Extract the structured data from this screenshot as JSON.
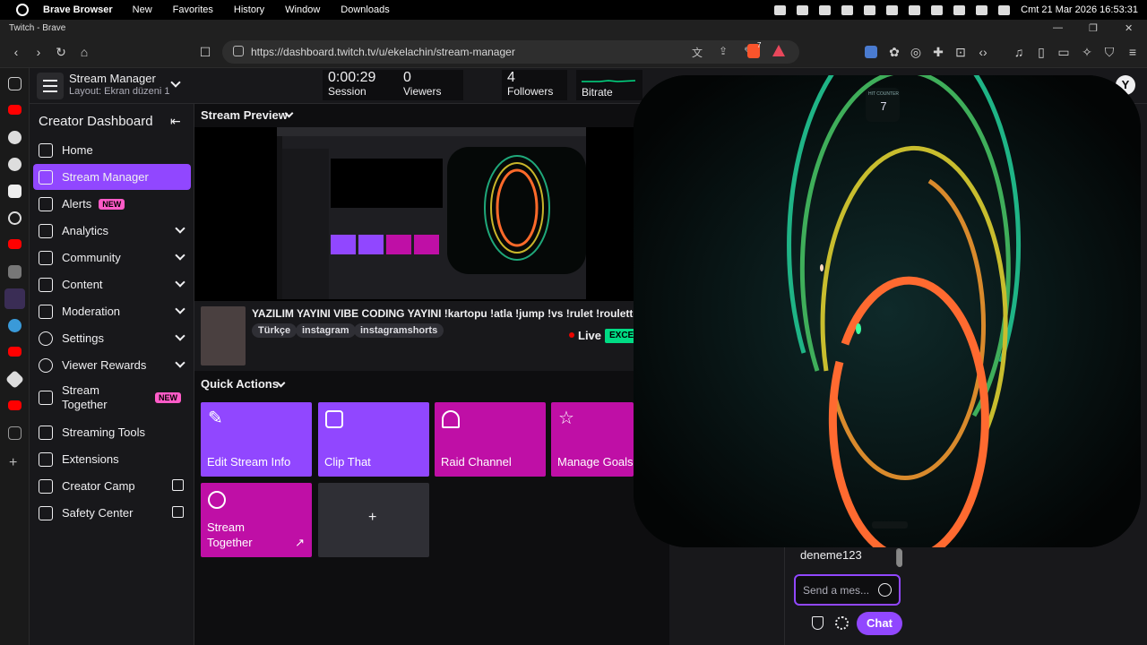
{
  "os_menu": {
    "app_name": "Brave Browser",
    "items": [
      "New",
      "Favorites",
      "History",
      "Window",
      "Downloads"
    ],
    "clock": "Cmt 21 Mar 2026  16:53:31"
  },
  "window": {
    "title": "Twitch - Brave"
  },
  "browser": {
    "url": "https://dashboard.twitch.tv/u/ekelachin/stream-manager",
    "shield_count": "7"
  },
  "header": {
    "title": "Stream Manager",
    "layout": "Layout: Ekran düzeni 1",
    "stats": [
      {
        "value": "0:00:29",
        "label": "Session"
      },
      {
        "value": "0",
        "label": "Viewers"
      },
      {
        "value": "4",
        "label": "Followers"
      },
      {
        "value": "",
        "label": "Bitrate"
      }
    ]
  },
  "sidebar": {
    "title": "Creator Dashboard",
    "items": [
      {
        "label": "Home"
      },
      {
        "label": "Stream Manager"
      },
      {
        "label": "Alerts",
        "badge": "NEW"
      },
      {
        "label": "Analytics"
      },
      {
        "label": "Community"
      },
      {
        "label": "Content"
      },
      {
        "label": "Moderation"
      },
      {
        "label": "Settings"
      },
      {
        "label": "Viewer Rewards"
      },
      {
        "label": "Stream Together",
        "badge": "NEW"
      },
      {
        "label": "Streaming Tools"
      },
      {
        "label": "Extensions"
      },
      {
        "label": "Creator Camp"
      },
      {
        "label": "Safety Center"
      }
    ]
  },
  "preview": {
    "title": "Stream Preview"
  },
  "stream": {
    "title": "YAZILIM YAYINI VIBE CODING YAYINI !kartopu !atla !jump !vs !rulet !roulette",
    "tags": [
      "Türkçe",
      "instagram",
      "instagramshorts"
    ],
    "status": "Live",
    "quality": "EXCE"
  },
  "quick_actions": {
    "title": "Quick Actions",
    "items": [
      {
        "label": "Edit Stream Info"
      },
      {
        "label": "Clip That"
      },
      {
        "label": "Raid Channel"
      },
      {
        "label": "Manage Goals"
      },
      {
        "label": "Stream Together"
      },
      {
        "label": "+"
      }
    ]
  },
  "overlay": {
    "hit_counter_label": "HIT COUNTER",
    "hit_counter_value": "7"
  },
  "chat": {
    "username": "deneme123",
    "placeholder": "Send a mes...",
    "button": "Chat"
  },
  "colors": {
    "accent": "#9147ff",
    "pink": "#bf0fa6",
    "live": "#eb0400"
  }
}
